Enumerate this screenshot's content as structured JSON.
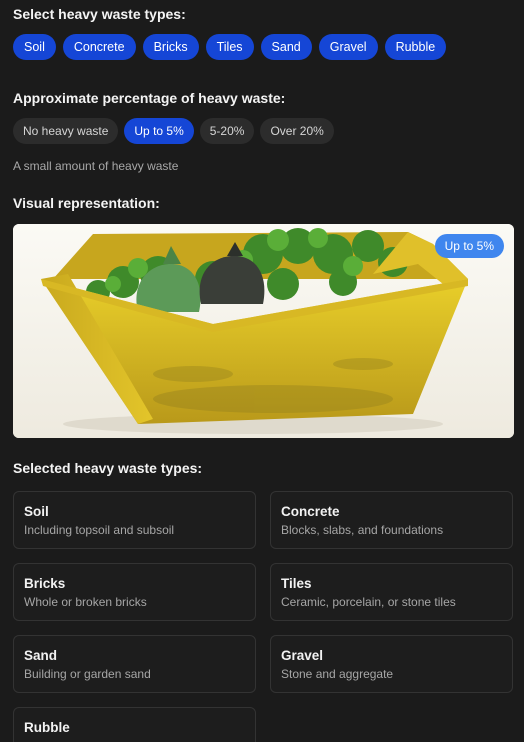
{
  "waste_types": {
    "heading": "Select heavy waste types:",
    "options": [
      "Soil",
      "Concrete",
      "Bricks",
      "Tiles",
      "Sand",
      "Gravel",
      "Rubble"
    ]
  },
  "percentage": {
    "heading": "Approximate percentage of heavy waste:",
    "options": [
      "No heavy waste",
      "Up to 5%",
      "5-20%",
      "Over 20%"
    ],
    "selected": "Up to 5%",
    "helper": "A small amount of heavy waste"
  },
  "visual": {
    "heading": "Visual representation:",
    "badge": "Up to 5%",
    "image_subject": "yellow skip with green garden waste and bags"
  },
  "selected_types": {
    "heading": "Selected heavy waste types:",
    "cards": [
      {
        "title": "Soil",
        "desc": "Including topsoil and subsoil"
      },
      {
        "title": "Concrete",
        "desc": "Blocks, slabs, and foundations"
      },
      {
        "title": "Bricks",
        "desc": "Whole or broken bricks"
      },
      {
        "title": "Tiles",
        "desc": "Ceramic, porcelain, or stone tiles"
      },
      {
        "title": "Sand",
        "desc": "Building or garden sand"
      },
      {
        "title": "Gravel",
        "desc": "Stone and aggregate"
      },
      {
        "title": "Rubble",
        "desc": ""
      }
    ]
  },
  "colors": {
    "accent": "#1546d6",
    "badge": "#3f86ee",
    "background": "#1b1b1b"
  }
}
